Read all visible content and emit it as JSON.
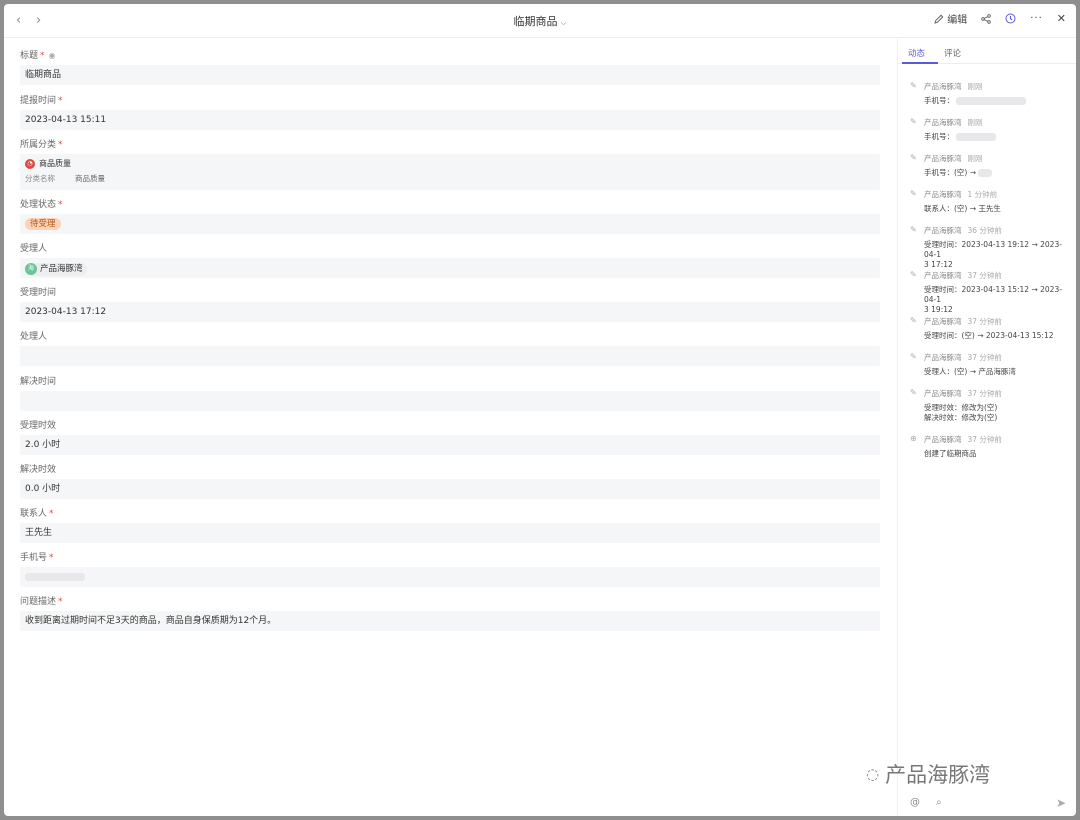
{
  "titlebar": {
    "title": "临期商品",
    "edit_label": "编辑"
  },
  "fields": {
    "title": {
      "label": "标题",
      "value": "临期商品"
    },
    "report_time": {
      "label": "提报时间",
      "value": "2023-04-13 15:11"
    },
    "category": {
      "label": "所属分类",
      "value": "商品质量",
      "sub_label": "分类名称",
      "sub_value": "商品质量"
    },
    "status": {
      "label": "处理状态",
      "value": "待受理"
    },
    "assignee": {
      "label": "受理人",
      "avatar_text": "海",
      "value": "产品海豚湾"
    },
    "accept_time": {
      "label": "受理时间",
      "value": "2023-04-13 17:12"
    },
    "handler": {
      "label": "处理人",
      "value": ""
    },
    "resolve_time": {
      "label": "解决时间",
      "value": ""
    },
    "accept_sla": {
      "label": "受理时效",
      "value": "2.0 小时"
    },
    "resolve_sla": {
      "label": "解决时效",
      "value": "0.0 小时"
    },
    "contact": {
      "label": "联系人",
      "value": "王先生"
    },
    "phone": {
      "label": "手机号",
      "value": ""
    },
    "description": {
      "label": "问题描述",
      "value": "收到距离过期时间不足3天的商品，商品自身保质期为12个月。"
    }
  },
  "sidebar": {
    "tab_activity": "动态",
    "tab_comments": "评论",
    "activities": [
      {
        "user": "产品海豚湾",
        "time": "刚刚",
        "line1": "手机号：",
        "line2": ""
      },
      {
        "user": "产品海豚湾",
        "time": "刚刚",
        "line1": "手机号：",
        "line2": ""
      },
      {
        "user": "产品海豚湾",
        "time": "刚刚",
        "line1": "手机号：(空) →",
        "line2": ""
      },
      {
        "user": "产品海豚湾",
        "time": "1 分钟前",
        "line1": "联系人：(空) → 王先生",
        "line2": ""
      },
      {
        "user": "产品海豚湾",
        "time": "36 分钟前",
        "line1": "受理时间：2023-04-13 19:12 → 2023-04-1",
        "line2": "3 17:12"
      },
      {
        "user": "产品海豚湾",
        "time": "37 分钟前",
        "line1": "受理时间：2023-04-13 15:12 → 2023-04-1",
        "line2": "3 19:12"
      },
      {
        "user": "产品海豚湾",
        "time": "37 分钟前",
        "line1": "受理时间：(空) → 2023-04-13 15:12",
        "line2": ""
      },
      {
        "user": "产品海豚湾",
        "time": "37 分钟前",
        "line1": "受理人：(空) → 产品海豚湾",
        "line2": ""
      },
      {
        "user": "产品海豚湾",
        "time": "37 分钟前",
        "line1": "受理时效：修改为(空)",
        "line2": "解决时效：修改为(空)"
      },
      {
        "user": "产品海豚湾",
        "time": "37 分钟前",
        "line1": "创建了临期商品",
        "line2": ""
      }
    ]
  },
  "watermark": {
    "text": "产品海豚湾"
  }
}
